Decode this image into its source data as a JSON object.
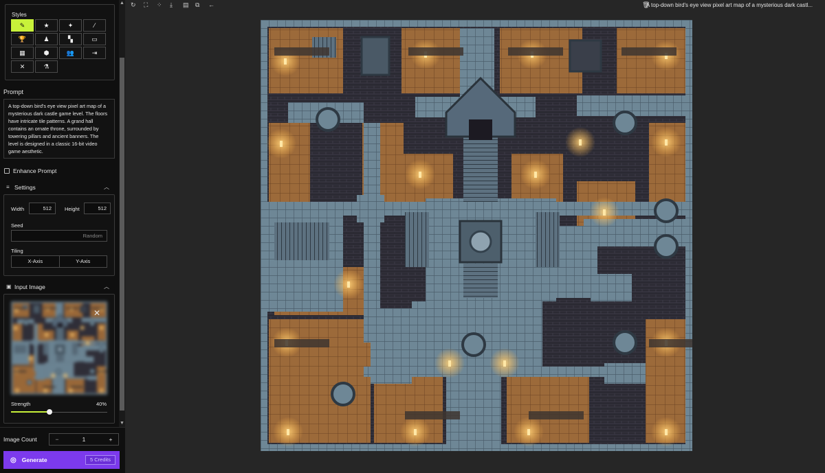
{
  "sidebar": {
    "styles": {
      "label": "Styles",
      "buttons": [
        {
          "icon": "pencil-icon",
          "glyph": "✎",
          "active": true
        },
        {
          "icon": "star-icon",
          "glyph": "★",
          "active": false
        },
        {
          "icon": "sparkles-icon",
          "glyph": "✦",
          "active": false
        },
        {
          "icon": "brush-icon",
          "glyph": "⁄",
          "active": false
        },
        {
          "icon": "trophy-icon",
          "glyph": "🏆",
          "active": false
        },
        {
          "icon": "person-icon",
          "glyph": "♟",
          "active": false
        },
        {
          "icon": "layout-icon",
          "glyph": "▚",
          "active": false
        },
        {
          "icon": "chat-icon",
          "glyph": "▭",
          "active": false
        },
        {
          "icon": "table-icon",
          "glyph": "▦",
          "active": false
        },
        {
          "icon": "cube-icon",
          "glyph": "⬢",
          "active": false
        },
        {
          "icon": "users-icon",
          "glyph": "👥",
          "active": false
        },
        {
          "icon": "arrow-right-icon",
          "glyph": "⇥",
          "active": false
        },
        {
          "icon": "close-icon",
          "glyph": "✕",
          "active": false
        },
        {
          "icon": "flask-icon",
          "glyph": "⚗",
          "active": false
        }
      ]
    },
    "prompt": {
      "label": "Prompt",
      "text": "A top-down bird's eye view pixel art map of a mysterious dark castle game level. The floors have intricate tile patterns. A grand hall contains an ornate throne, surrounded by towering pillars and ancient banners. The level is designed in a classic 16-bit video game aesthetic."
    },
    "enhance_prompt": {
      "label": "Enhance Prompt",
      "checked": false
    },
    "settings": {
      "label": "Settings",
      "width_label": "Width",
      "width_value": "512",
      "height_label": "Height",
      "height_value": "512",
      "seed_label": "Seed",
      "seed_placeholder": "Random",
      "tiling_label": "Tiling",
      "tiling_x": "X-Axis",
      "tiling_y": "Y-Axis"
    },
    "input_image": {
      "label": "Input Image",
      "strength_label": "Strength",
      "strength_value": "40%",
      "strength_fraction": 0.4
    },
    "image_count": {
      "label": "Image Count",
      "value": "1",
      "minus": "−",
      "plus": "+"
    },
    "generate": {
      "label": "Generate",
      "credits": "5 Credits"
    }
  },
  "toolbar": {
    "title": "A top-down bird's eye view pixel art map of a mysterious dark castl...",
    "icons": [
      "refresh-icon",
      "fullscreen-icon",
      "grid-icon",
      "download-icon",
      "save-icon",
      "copy-icon",
      "back-arrow-icon",
      "trash-icon"
    ]
  },
  "colors": {
    "accent_green": "#c8f23a",
    "generate_purple": "#7c3aed",
    "stone_blue": "#6e8796",
    "floor_brown": "#9c6a3a",
    "wall_dark": "#2b2a33"
  }
}
